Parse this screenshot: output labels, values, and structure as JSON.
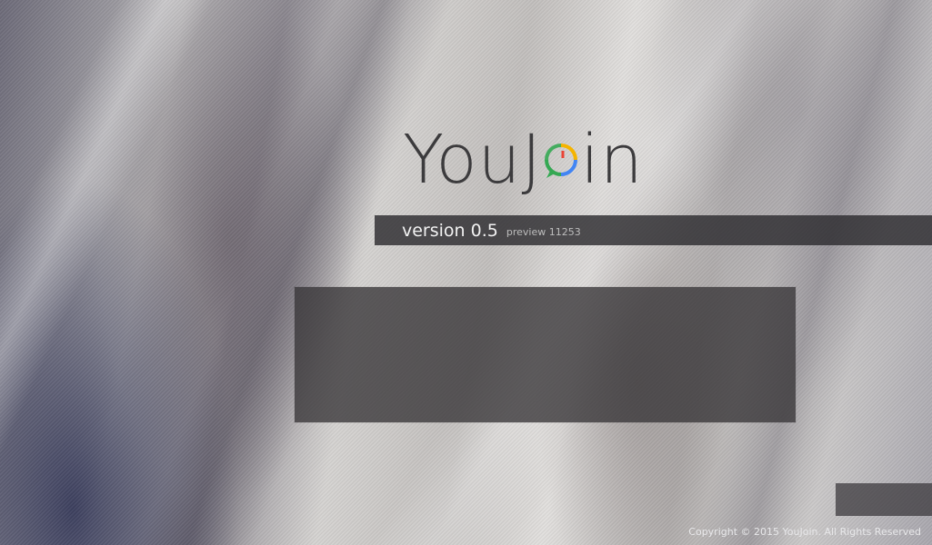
{
  "app": {
    "logo_prefix": "YouJ",
    "logo_suffix": "in",
    "logo_full": "YouJoin",
    "logo_colors": [
      "#f5b400",
      "#35a853",
      "#4285f4",
      "#ea4335"
    ]
  },
  "version": {
    "label": "version 0.5",
    "preview": "preview 11253"
  },
  "footer": {
    "copyright": "Copyright © 2015 YouJoin. All Rights Reserved"
  }
}
